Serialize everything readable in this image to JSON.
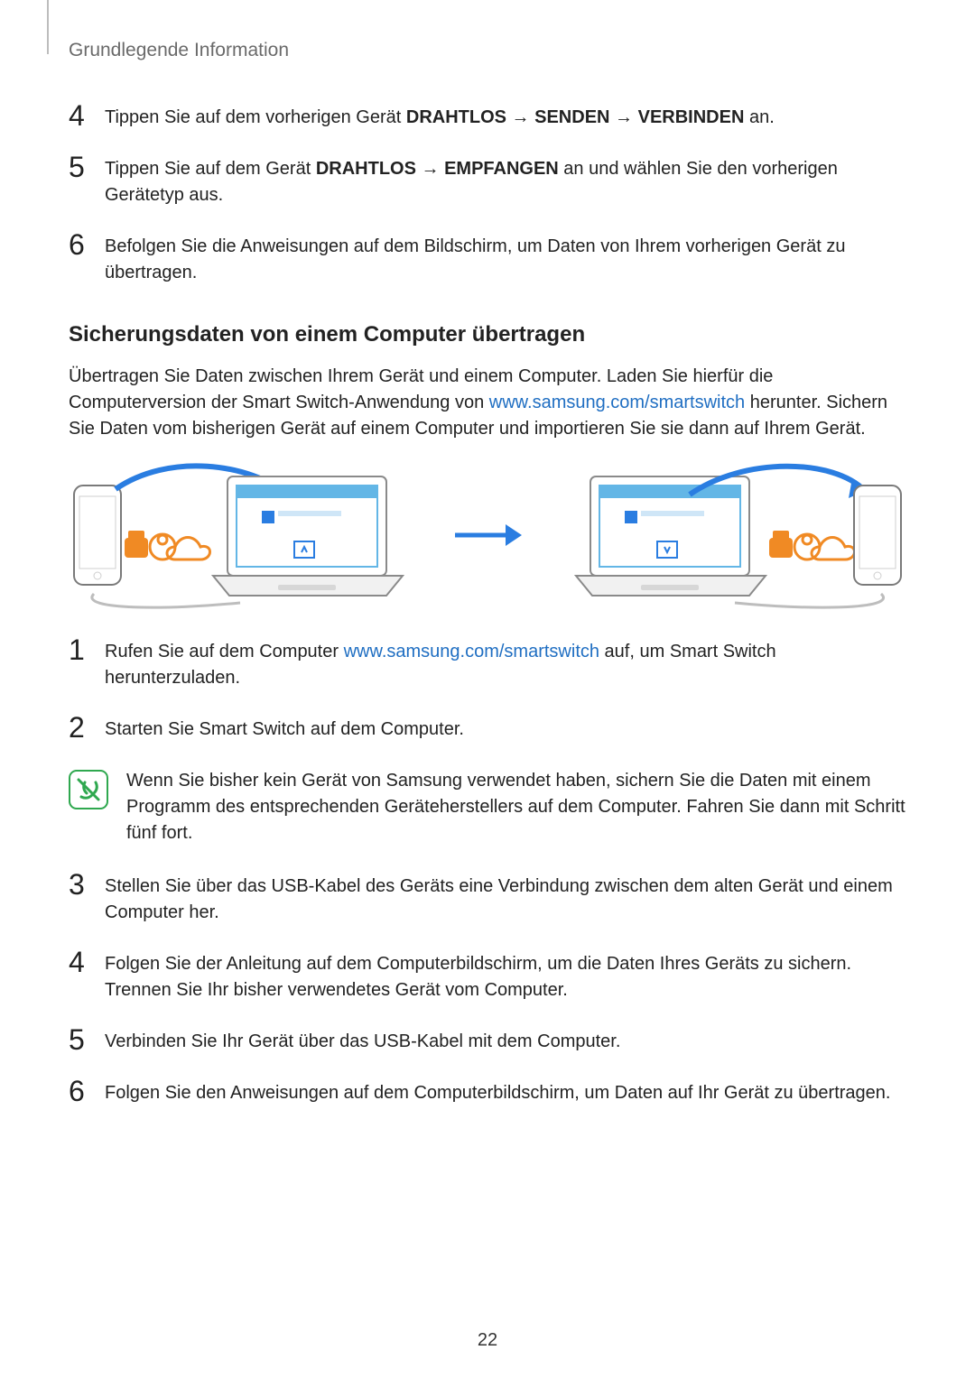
{
  "header": {
    "section": "Grundlegende Information"
  },
  "top_steps": [
    {
      "num": "4",
      "parts": [
        {
          "t": "Tippen Sie auf dem vorherigen Gerät ",
          "b": false
        },
        {
          "t": "DRAHTLOS",
          "b": true
        },
        {
          "t": " → ",
          "b": false
        },
        {
          "t": "SENDEN",
          "b": true
        },
        {
          "t": " → ",
          "b": false
        },
        {
          "t": "VERBINDEN",
          "b": true
        },
        {
          "t": " an.",
          "b": false
        }
      ]
    },
    {
      "num": "5",
      "parts": [
        {
          "t": "Tippen Sie auf dem Gerät ",
          "b": false
        },
        {
          "t": "DRAHTLOS",
          "b": true
        },
        {
          "t": " → ",
          "b": false
        },
        {
          "t": "EMPFANGEN",
          "b": true
        },
        {
          "t": " an und wählen Sie den vorherigen Gerätetyp aus.",
          "b": false
        }
      ]
    },
    {
      "num": "6",
      "parts": [
        {
          "t": "Befolgen Sie die Anweisungen auf dem Bildschirm, um Daten von Ihrem vorherigen Gerät zu übertragen.",
          "b": false
        }
      ]
    }
  ],
  "subheading": "Sicherungsdaten von einem Computer übertragen",
  "intro": {
    "pre": "Übertragen Sie Daten zwischen Ihrem Gerät und einem Computer. Laden Sie hierfür die Computerversion der Smart Switch-Anwendung von ",
    "link": "www.samsung.com/smartswitch",
    "post": " herunter. Sichern Sie Daten vom bisherigen Gerät auf einem Computer und importieren Sie sie dann auf Ihrem Gerät."
  },
  "bottom_steps": [
    {
      "num": "1",
      "parts": [
        {
          "t": "Rufen Sie auf dem Computer ",
          "b": false
        },
        {
          "t": "www.samsung.com/smartswitch",
          "link": true
        },
        {
          "t": " auf, um Smart Switch herunterzuladen.",
          "b": false
        }
      ]
    },
    {
      "num": "2",
      "parts": [
        {
          "t": "Starten Sie Smart Switch auf dem Computer.",
          "b": false
        }
      ]
    }
  ],
  "note": "Wenn Sie bisher kein Gerät von Samsung verwendet haben, sichern Sie die Daten mit einem Programm des entsprechenden Geräteherstellers auf dem Computer. Fahren Sie dann mit Schritt fünf fort.",
  "bottom_steps2": [
    {
      "num": "3",
      "parts": [
        {
          "t": "Stellen Sie über das USB-Kabel des Geräts eine Verbindung zwischen dem alten Gerät und einem Computer her.",
          "b": false
        }
      ]
    },
    {
      "num": "4",
      "parts": [
        {
          "t": "Folgen Sie der Anleitung auf dem Computerbildschirm, um die Daten Ihres Geräts zu sichern. Trennen Sie Ihr bisher verwendetes Gerät vom Computer.",
          "b": false
        }
      ]
    },
    {
      "num": "5",
      "parts": [
        {
          "t": "Verbinden Sie Ihr Gerät über das USB-Kabel mit dem Computer.",
          "b": false
        }
      ]
    },
    {
      "num": "6",
      "parts": [
        {
          "t": "Folgen Sie den Anweisungen auf dem Computerbildschirm, um Daten auf Ihr Gerät zu übertragen.",
          "b": false
        }
      ]
    }
  ],
  "page_number": "22",
  "colors": {
    "link": "#1f6ec2",
    "arrow": "#2a7de1",
    "noteBorder": "#2fa84f",
    "orange": "#f08a24"
  }
}
